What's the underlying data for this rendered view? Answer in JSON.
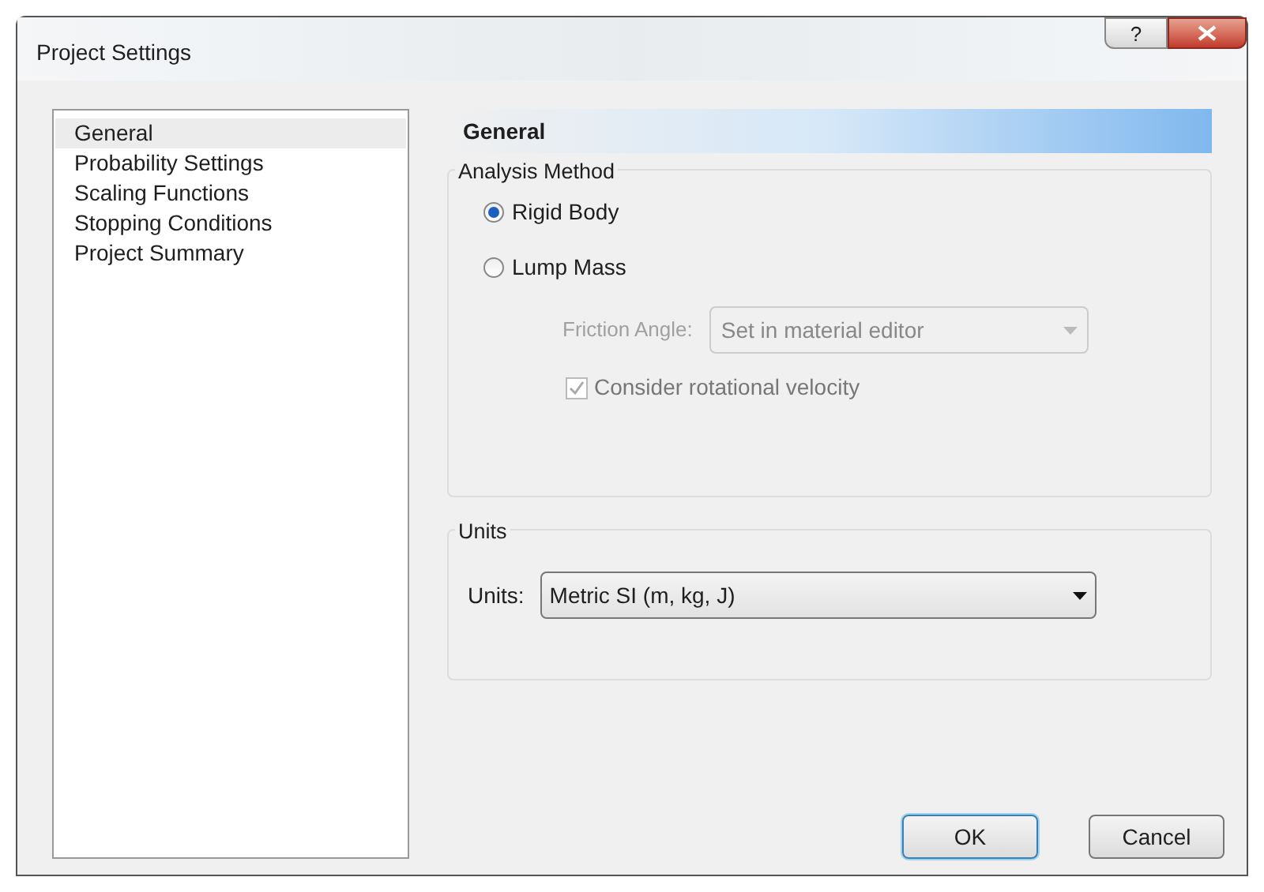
{
  "window": {
    "title": "Project Settings",
    "help_button": "?"
  },
  "sidebar": {
    "items": [
      {
        "label": "General",
        "selected": true
      },
      {
        "label": "Probability Settings",
        "selected": false
      },
      {
        "label": "Scaling Functions",
        "selected": false
      },
      {
        "label": "Stopping Conditions",
        "selected": false
      },
      {
        "label": "Project Summary",
        "selected": false
      }
    ]
  },
  "page_title": "General",
  "analysis_method": {
    "title": "Analysis Method",
    "options": [
      {
        "label": "Rigid Body",
        "selected": true
      },
      {
        "label": "Lump Mass",
        "selected": false
      }
    ],
    "friction_angle": {
      "label": "Friction Angle:",
      "value": "Set in material editor",
      "disabled": true
    },
    "rotational_velocity": {
      "label": "Consider rotational velocity",
      "checked": true,
      "disabled": true
    }
  },
  "units": {
    "title": "Units",
    "label": "Units:",
    "value": "Metric SI (m, kg, J)"
  },
  "buttons": [
    {
      "label": "OK",
      "default": true
    },
    {
      "label": "Cancel",
      "default": false
    }
  ]
}
